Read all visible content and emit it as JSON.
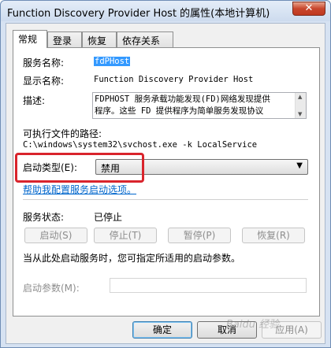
{
  "window": {
    "title": "Function Discovery Provider Host 的属性(本地计算机)",
    "close_glyph": "✕"
  },
  "tabs": [
    {
      "label": "常规",
      "active": true
    },
    {
      "label": "登录"
    },
    {
      "label": "恢复"
    },
    {
      "label": "依存关系"
    }
  ],
  "general": {
    "service_name_label": "服务名称:",
    "service_name_value": "fdPHost",
    "display_name_label": "显示名称:",
    "display_name_value": "Function Discovery Provider Host",
    "description_label": "描述:",
    "description_value": "FDPHOST 服务承载功能发现(FD)网络发现提供\n程序。这些 FD 提供程序为简单服务发现协议",
    "exe_path_label": "可执行文件的路径:",
    "exe_path_value": "C:\\windows\\system32\\svchost.exe -k LocalService",
    "startup_type_label": "启动类型(E):",
    "startup_type_value": "禁用",
    "help_link": "帮助我配置服务启动选项。",
    "service_status_label": "服务状态:",
    "service_status_value": "已停止",
    "buttons": {
      "start": "启动(S)",
      "stop": "停止(T)",
      "pause": "暂停(P)",
      "resume": "恢复(R)"
    },
    "start_hint": "当从此处启动服务时，您可指定所适用的启动参数。",
    "start_params_label": "启动参数(M):",
    "start_params_value": ""
  },
  "footer": {
    "ok": "确定",
    "cancel": "取消",
    "apply": "应用(A)"
  },
  "watermark": "Baidu 经验",
  "colors": {
    "highlight_border": "#d9242c",
    "link": "#0066cc",
    "selection": "#3399ff"
  }
}
